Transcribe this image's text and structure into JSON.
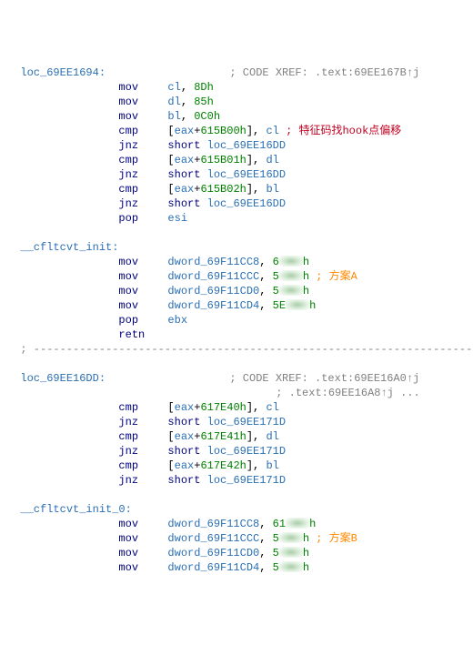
{
  "block1": {
    "label": "loc_69EE1694:",
    "xref": "; CODE XREF: .text:69EE167B↑j",
    "lines": [
      {
        "m": "mov",
        "ops": [
          {
            "t": "reg",
            "v": "cl"
          },
          {
            "t": "p",
            "v": ", "
          },
          {
            "t": "num",
            "v": "8Dh"
          }
        ]
      },
      {
        "m": "mov",
        "ops": [
          {
            "t": "reg",
            "v": "dl"
          },
          {
            "t": "p",
            "v": ", "
          },
          {
            "t": "num",
            "v": "85h"
          }
        ]
      },
      {
        "m": "mov",
        "ops": [
          {
            "t": "reg",
            "v": "bl"
          },
          {
            "t": "p",
            "v": ", "
          },
          {
            "t": "num",
            "v": "0C0h"
          }
        ]
      },
      {
        "m": "cmp",
        "ops": [
          {
            "t": "p",
            "v": "["
          },
          {
            "t": "reg",
            "v": "eax"
          },
          {
            "t": "p",
            "v": "+"
          },
          {
            "t": "num",
            "v": "615B00h"
          },
          {
            "t": "p",
            "v": "], "
          },
          {
            "t": "reg",
            "v": "cl"
          }
        ],
        "cmtc": " ; 特征码找hook点偏移"
      },
      {
        "m": "jnz",
        "ops": [
          {
            "t": "kw",
            "v": "short "
          },
          {
            "t": "lbl",
            "v": "loc_69EE16DD"
          }
        ]
      },
      {
        "m": "cmp",
        "ops": [
          {
            "t": "p",
            "v": "["
          },
          {
            "t": "reg",
            "v": "eax"
          },
          {
            "t": "p",
            "v": "+"
          },
          {
            "t": "num",
            "v": "615B01h"
          },
          {
            "t": "p",
            "v": "], "
          },
          {
            "t": "reg",
            "v": "dl"
          }
        ]
      },
      {
        "m": "jnz",
        "ops": [
          {
            "t": "kw",
            "v": "short "
          },
          {
            "t": "lbl",
            "v": "loc_69EE16DD"
          }
        ]
      },
      {
        "m": "cmp",
        "ops": [
          {
            "t": "p",
            "v": "["
          },
          {
            "t": "reg",
            "v": "eax"
          },
          {
            "t": "p",
            "v": "+"
          },
          {
            "t": "num",
            "v": "615B02h"
          },
          {
            "t": "p",
            "v": "], "
          },
          {
            "t": "reg",
            "v": "bl"
          }
        ]
      },
      {
        "m": "jnz",
        "ops": [
          {
            "t": "kw",
            "v": "short "
          },
          {
            "t": "lbl",
            "v": "loc_69EE16DD"
          }
        ]
      },
      {
        "m": "pop",
        "ops": [
          {
            "t": "reg",
            "v": "esi"
          }
        ]
      }
    ]
  },
  "block2": {
    "label": "__cfltcvt_init:",
    "lines": [
      {
        "m": "mov",
        "ops": [
          {
            "t": "lbl",
            "v": "dword_69F11CC8"
          },
          {
            "t": "p",
            "v": ", "
          },
          {
            "t": "num",
            "v": "6"
          },
          {
            "t": "blur",
            "v": ""
          },
          {
            "t": "num",
            "v": "h"
          }
        ]
      },
      {
        "m": "mov",
        "ops": [
          {
            "t": "lbl",
            "v": "dword_69F11CCC"
          },
          {
            "t": "p",
            "v": ", "
          },
          {
            "t": "num",
            "v": "5"
          },
          {
            "t": "blur",
            "v": ""
          },
          {
            "t": "num",
            "v": "h"
          }
        ],
        "ann": " ; 方案A"
      },
      {
        "m": "mov",
        "ops": [
          {
            "t": "lbl",
            "v": "dword_69F11CD0"
          },
          {
            "t": "p",
            "v": ", "
          },
          {
            "t": "num",
            "v": "5"
          },
          {
            "t": "blur",
            "v": ""
          },
          {
            "t": "num",
            "v": "h"
          }
        ]
      },
      {
        "m": "mov",
        "ops": [
          {
            "t": "lbl",
            "v": "dword_69F11CD4"
          },
          {
            "t": "p",
            "v": ", "
          },
          {
            "t": "num",
            "v": "5E"
          },
          {
            "t": "blur",
            "v": ""
          },
          {
            "t": "num",
            "v": "h"
          }
        ]
      },
      {
        "m": "pop",
        "ops": [
          {
            "t": "reg",
            "v": "ebx"
          }
        ]
      },
      {
        "m": "retn",
        "ops": []
      }
    ]
  },
  "sep": "; ---------------------------------------------------------------------------",
  "block3": {
    "label": "loc_69EE16DD:",
    "xref": "; CODE XREF: .text:69EE16A0↑j",
    "xref2": "; .text:69EE16A8↑j ...",
    "lines": [
      {
        "m": "cmp",
        "ops": [
          {
            "t": "p",
            "v": "["
          },
          {
            "t": "reg",
            "v": "eax"
          },
          {
            "t": "p",
            "v": "+"
          },
          {
            "t": "num",
            "v": "617E40h"
          },
          {
            "t": "p",
            "v": "], "
          },
          {
            "t": "reg",
            "v": "cl"
          }
        ]
      },
      {
        "m": "jnz",
        "ops": [
          {
            "t": "kw",
            "v": "short "
          },
          {
            "t": "lbl",
            "v": "loc_69EE171D"
          }
        ]
      },
      {
        "m": "cmp",
        "ops": [
          {
            "t": "p",
            "v": "["
          },
          {
            "t": "reg",
            "v": "eax"
          },
          {
            "t": "p",
            "v": "+"
          },
          {
            "t": "num",
            "v": "617E41h"
          },
          {
            "t": "p",
            "v": "], "
          },
          {
            "t": "reg",
            "v": "dl"
          }
        ]
      },
      {
        "m": "jnz",
        "ops": [
          {
            "t": "kw",
            "v": "short "
          },
          {
            "t": "lbl",
            "v": "loc_69EE171D"
          }
        ]
      },
      {
        "m": "cmp",
        "ops": [
          {
            "t": "p",
            "v": "["
          },
          {
            "t": "reg",
            "v": "eax"
          },
          {
            "t": "p",
            "v": "+"
          },
          {
            "t": "num",
            "v": "617E42h"
          },
          {
            "t": "p",
            "v": "], "
          },
          {
            "t": "reg",
            "v": "bl"
          }
        ]
      },
      {
        "m": "jnz",
        "ops": [
          {
            "t": "kw",
            "v": "short "
          },
          {
            "t": "lbl",
            "v": "loc_69EE171D"
          }
        ]
      }
    ]
  },
  "block4": {
    "label": "__cfltcvt_init_0:",
    "lines": [
      {
        "m": "mov",
        "ops": [
          {
            "t": "lbl",
            "v": "dword_69F11CC8"
          },
          {
            "t": "p",
            "v": ", "
          },
          {
            "t": "num",
            "v": "61"
          },
          {
            "t": "blur",
            "v": ""
          },
          {
            "t": "num",
            "v": "h"
          }
        ]
      },
      {
        "m": "mov",
        "ops": [
          {
            "t": "lbl",
            "v": "dword_69F11CCC"
          },
          {
            "t": "p",
            "v": ", "
          },
          {
            "t": "num",
            "v": "5"
          },
          {
            "t": "blur",
            "v": ""
          },
          {
            "t": "num",
            "v": "h"
          }
        ],
        "ann": " ; 方案B"
      },
      {
        "m": "mov",
        "ops": [
          {
            "t": "lbl",
            "v": "dword_69F11CD0"
          },
          {
            "t": "p",
            "v": ", "
          },
          {
            "t": "num",
            "v": "5"
          },
          {
            "t": "blur",
            "v": ""
          },
          {
            "t": "num",
            "v": "h"
          }
        ]
      },
      {
        "m": "mov",
        "ops": [
          {
            "t": "lbl",
            "v": "dword_69F11CD4"
          },
          {
            "t": "p",
            "v": ", "
          },
          {
            "t": "num",
            "v": "5"
          },
          {
            "t": "blur",
            "v": ""
          },
          {
            "t": "num",
            "v": "h"
          }
        ]
      }
    ]
  }
}
